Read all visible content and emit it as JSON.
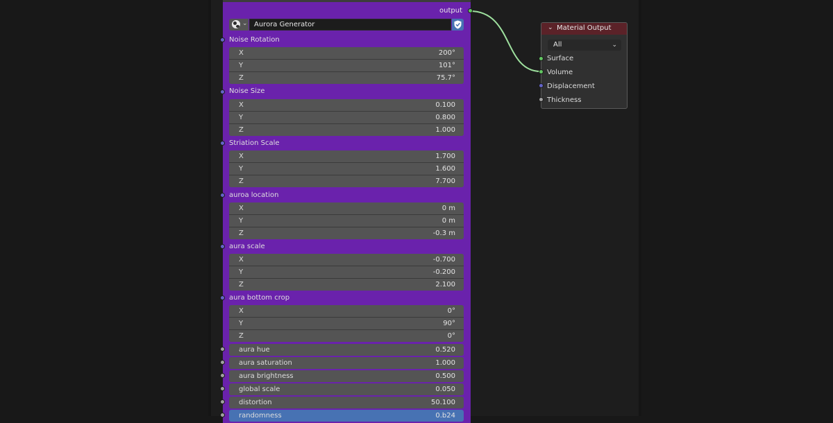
{
  "group_node": {
    "output_label": "output",
    "node_group_name": "Aurora Generator",
    "vector_inputs": [
      {
        "label": "Noise Rotation",
        "x": "200°",
        "y": "101°",
        "z": "75.7°"
      },
      {
        "label": "Noise Size",
        "x": "0.100",
        "y": "0.800",
        "z": "1.000"
      },
      {
        "label": "Striation Scale",
        "x": "1.700",
        "y": "1.600",
        "z": "7.700"
      },
      {
        "label": "auroa location",
        "x": "0 m",
        "y": "0 m",
        "z": "-0.3 m"
      },
      {
        "label": "aura scale",
        "x": "-0.700",
        "y": "-0.200",
        "z": "2.100"
      },
      {
        "label": "aura bottom crop",
        "x": "0°",
        "y": "90°",
        "z": "0°"
      }
    ],
    "axis_labels": {
      "x": "X",
      "y": "Y",
      "z": "Z"
    },
    "float_inputs": [
      {
        "label": "aura hue",
        "value": "0.520"
      },
      {
        "label": "aura saturation",
        "value": "1.000"
      },
      {
        "label": "aura brightness",
        "value": "0.500"
      },
      {
        "label": "global scale",
        "value": "0.050"
      },
      {
        "label": "distortion",
        "value": "50.100"
      },
      {
        "label": "randomness",
        "value": "0.b24"
      }
    ]
  },
  "material_output": {
    "title": "Material Output",
    "target": "All",
    "inputs": [
      "Surface",
      "Volume",
      "Displacement",
      "Thickness"
    ]
  },
  "icons": {
    "datablock": "sphere-icon",
    "fake_user": "shield-icon",
    "collapse": "chevron-down-icon",
    "dropdown": "chevron-down-icon"
  },
  "colors": {
    "group_node_body": "#6a22ac",
    "material_header": "#5b2228",
    "vector_socket": "#6464c8",
    "float_socket": "#a1a1a1",
    "shader_socket": "#63c763",
    "wire": "#9ee09e",
    "field": "#545454",
    "highlight": "#4772b3"
  }
}
